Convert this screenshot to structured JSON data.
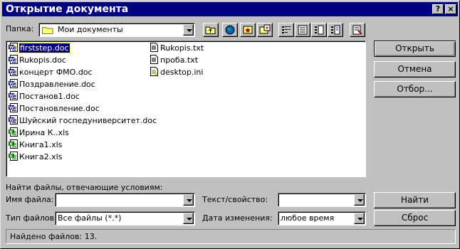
{
  "window": {
    "title": "Открытие документа",
    "help_icon": "?",
    "close_icon": "×"
  },
  "toolbar": {
    "folder_label": "Папка:",
    "folder_value": "Мои документы"
  },
  "files": {
    "col1": [
      {
        "name": "firststep.doc",
        "icon": "word-doc-icon",
        "selected": true
      },
      {
        "name": "Rukopis.doc",
        "icon": "word-doc-icon"
      },
      {
        "name": "концерт ФМО.doc",
        "icon": "word-doc-icon"
      },
      {
        "name": "Поздравление.doc",
        "icon": "word-doc-icon"
      },
      {
        "name": "Постанов1.doc",
        "icon": "word-doc-icon"
      },
      {
        "name": "Постановление.doc",
        "icon": "word-doc-icon"
      },
      {
        "name": "Шуйский госпедуниверситет.doc",
        "icon": "word-doc-icon"
      },
      {
        "name": "Ирина К..xls",
        "icon": "excel-xls-icon"
      },
      {
        "name": "Книга1.xls",
        "icon": "excel-xls-icon"
      },
      {
        "name": "Книга2.xls",
        "icon": "excel-xls-icon"
      }
    ],
    "col2": [
      {
        "name": "Rukopis.txt",
        "icon": "text-file-icon"
      },
      {
        "name": "проба.txt",
        "icon": "text-file-icon"
      },
      {
        "name": "desktop.ini",
        "icon": "ini-file-icon"
      }
    ]
  },
  "buttons": {
    "open": "Открыть",
    "cancel": "Отмена",
    "filter": "Отбор...",
    "find": "Найти",
    "reset": "Сброс"
  },
  "search": {
    "heading": "Найти файлы, отвечающие условиям:",
    "filename_label": "Имя файла:",
    "filename_value": "",
    "filetype_label": "Тип файлов:",
    "filetype_value": "Все файлы (*.*)",
    "text_label": "Текст/свойство:",
    "text_value": "",
    "date_label": "Дата изменения:",
    "date_value": "любое время"
  },
  "status": {
    "text": "Найдено файлов: 13."
  },
  "colors": {
    "title_bg": "#000080",
    "selection": "#000080",
    "face": "#c0c0c0"
  }
}
